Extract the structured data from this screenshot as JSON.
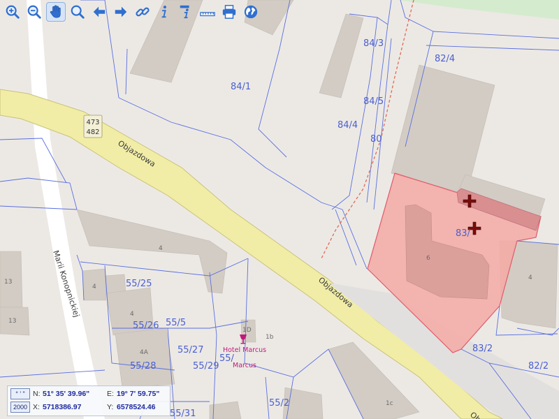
{
  "toolbar": {
    "buttons": [
      {
        "name": "zoom-in-button",
        "icon": "zoom-in-icon"
      },
      {
        "name": "zoom-out-button",
        "icon": "zoom-out-icon"
      },
      {
        "name": "pan-button",
        "icon": "hand-icon",
        "active": true
      },
      {
        "name": "zoom-extent-button",
        "icon": "zoom-icon"
      },
      {
        "name": "back-button",
        "icon": "arrow-left-icon"
      },
      {
        "name": "forward-button",
        "icon": "arrow-right-icon"
      },
      {
        "name": "link-button",
        "icon": "link-icon"
      },
      {
        "name": "info-button",
        "icon": "info-icon"
      },
      {
        "name": "info-list-button",
        "icon": "info-doc-icon"
      },
      {
        "name": "measure-button",
        "icon": "ruler-icon"
      },
      {
        "name": "print-button",
        "icon": "printer-icon"
      },
      {
        "name": "globe-button",
        "icon": "globe-icon"
      }
    ],
    "accent": "#2f6fcf"
  },
  "map": {
    "colors": {
      "background": "#ece9e5",
      "road": "#f1eda6",
      "road_edge": "#c9c27a",
      "street": "#ffffff",
      "building": "#d3ccc4",
      "parcel_line": "#5a6fe0",
      "selected_fill": "#f4a9a5",
      "selected_edge": "#e05a6a",
      "green": "#d5ebce",
      "marker": "#8a1010"
    },
    "parcel_labels": [
      "84/3",
      "82/4",
      "84/1",
      "84/5",
      "84/4",
      "80",
      "83/",
      "55/25",
      "55/26",
      "55/5",
      "55/27",
      "55/28",
      "55/29",
      "55/",
      "55/2",
      "55/31",
      "83/2",
      "82/2"
    ],
    "building_labels": [
      "4",
      "13",
      "13",
      "4",
      "4",
      "4A",
      "4",
      "6",
      "1D",
      "1b",
      "1c"
    ],
    "road_labels": {
      "objazdowa_1": "Objazdowa",
      "objazdowa_2": "Objazdowa",
      "objazdowa_3": "Ob",
      "konopnickiej": "Marii Konopnickiej"
    },
    "route_badge": {
      "top": "473",
      "bottom": "482"
    },
    "poi": {
      "line1": "Hotel Marcus",
      "line2": "Marcus",
      "icon": "wine-glass-icon"
    }
  },
  "coords": {
    "dms_button": "° ' \"",
    "n_label": "N:",
    "n_value": "51° 35' 39.96\"",
    "e_label": "E:",
    "e_value": "19° 7' 59.75\"",
    "sys_button": "2000",
    "x_label": "X:",
    "x_value": "5718386.97",
    "y_label": "Y:",
    "y_value": "6578524.46"
  }
}
